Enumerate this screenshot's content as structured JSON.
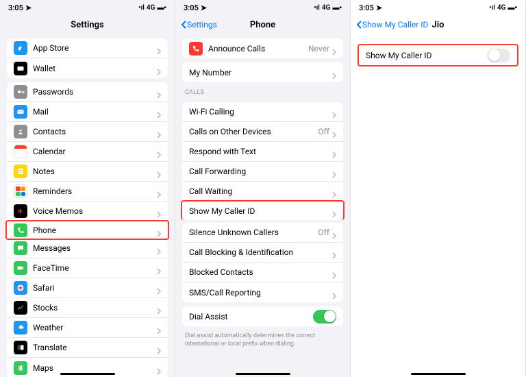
{
  "status": {
    "time": "3:05",
    "network": "4G"
  },
  "panel1": {
    "title": "Settings",
    "grp1": [
      {
        "name": "appstore",
        "label": "App Store",
        "bg": "#1d95f2"
      },
      {
        "name": "wallet",
        "label": "Wallet",
        "bg": "#000"
      }
    ],
    "grp2": [
      {
        "name": "passwords",
        "label": "Passwords",
        "bg": "#8e8e93"
      },
      {
        "name": "mail",
        "label": "Mail",
        "bg": "#1d95f2"
      },
      {
        "name": "contacts",
        "label": "Contacts",
        "bg": "#8e8e93"
      },
      {
        "name": "calendar",
        "label": "Calendar",
        "bg": "#fff",
        "inner": "#ff3b30"
      },
      {
        "name": "notes",
        "label": "Notes",
        "bg": "#ffd60a"
      },
      {
        "name": "reminders",
        "label": "Reminders",
        "bg": "#fff",
        "multi": true
      },
      {
        "name": "voicememos",
        "label": "Voice Memos",
        "bg": "#000",
        "wave": true
      },
      {
        "name": "phone",
        "label": "Phone",
        "bg": "#34c759",
        "highlight": true
      },
      {
        "name": "messages",
        "label": "Messages",
        "bg": "#34c759"
      },
      {
        "name": "facetime",
        "label": "FaceTime",
        "bg": "#34c759"
      },
      {
        "name": "safari",
        "label": "Safari",
        "bg": "#1d95f2"
      },
      {
        "name": "stocks",
        "label": "Stocks",
        "bg": "#000"
      },
      {
        "name": "weather",
        "label": "Weather",
        "bg": "#1d95f2"
      },
      {
        "name": "translate",
        "label": "Translate",
        "bg": "#000"
      },
      {
        "name": "maps",
        "label": "Maps",
        "bg": "#34c759"
      }
    ]
  },
  "panel2": {
    "back": "Settings",
    "title": "Phone",
    "top": [
      {
        "name": "announce",
        "label": "Announce Calls",
        "detail": "Never",
        "bg": "#ff3b30"
      }
    ],
    "mynumber": "My Number",
    "calls_header": "CALLS",
    "calls": [
      {
        "name": "wifi-calling",
        "label": "Wi-Fi Calling"
      },
      {
        "name": "other-devices",
        "label": "Calls on Other Devices",
        "detail": "Off"
      },
      {
        "name": "respond-text",
        "label": "Respond with Text"
      },
      {
        "name": "call-forwarding",
        "label": "Call Forwarding"
      },
      {
        "name": "call-waiting",
        "label": "Call Waiting"
      },
      {
        "name": "caller-id",
        "label": "Show My Caller ID",
        "highlight": true
      }
    ],
    "grp3": [
      {
        "name": "silence-unknown",
        "label": "Silence Unknown Callers",
        "detail": "Off"
      },
      {
        "name": "call-blocking",
        "label": "Call Blocking & Identification"
      },
      {
        "name": "blocked-contacts",
        "label": "Blocked Contacts"
      },
      {
        "name": "sms-reporting",
        "label": "SMS/Call Reporting"
      }
    ],
    "dial_assist": "Dial Assist",
    "dial_foot": "Dial assist automatically determines the correct international or local prefix when dialing."
  },
  "panel3": {
    "back": "Show My Caller ID",
    "title": "Jio",
    "row": "Show My Caller ID"
  }
}
